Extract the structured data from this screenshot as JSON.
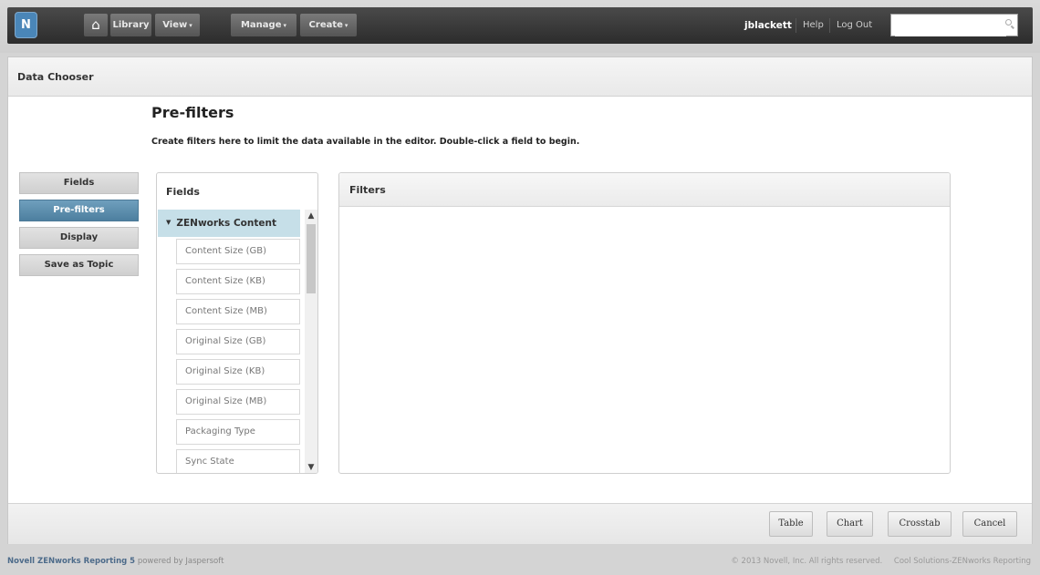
{
  "topbar": {
    "logo_glyph": "N",
    "home_glyph": "⌂",
    "nav": [
      {
        "label": "Library",
        "dropdown": false
      },
      {
        "label": "View",
        "dropdown": true
      },
      {
        "label": "Manage",
        "dropdown": true
      },
      {
        "label": "Create",
        "dropdown": true
      }
    ],
    "caret": "▾",
    "username": "jblackett",
    "help": "Help",
    "logout": "Log Out",
    "search_placeholder": ""
  },
  "panel": {
    "title": "Data Chooser",
    "page_title": "Pre-filters",
    "instructions": "Create filters here to limit the data available in the editor. Double-click a field to begin."
  },
  "steps": [
    {
      "label": "Fields",
      "active": false
    },
    {
      "label": "Pre-filters",
      "active": true
    },
    {
      "label": "Display",
      "active": false
    },
    {
      "label": "Save as Topic",
      "active": false
    }
  ],
  "fields": {
    "title": "Fields",
    "group": "ZENworks Content",
    "items": [
      "Content Size (GB)",
      "Content Size (KB)",
      "Content Size (MB)",
      "Original Size (GB)",
      "Original Size (KB)",
      "Original Size (MB)",
      "Packaging Type",
      "Sync State"
    ]
  },
  "filters": {
    "title": "Filters"
  },
  "footer_buttons": [
    "Table",
    "Chart",
    "Crosstab",
    "Cancel"
  ],
  "page_footer": {
    "product": "Novell ZENworks Reporting 5",
    "powered": "powered by Jaspersoft",
    "copyright": "© 2013 Novell, Inc. All rights reserved.",
    "link": "Cool Solutions-ZENworks Reporting"
  },
  "colors": {
    "active_step": "#4d7f9f",
    "group_highlight": "#c6dfe8",
    "topbar": "#2c2c2c"
  }
}
